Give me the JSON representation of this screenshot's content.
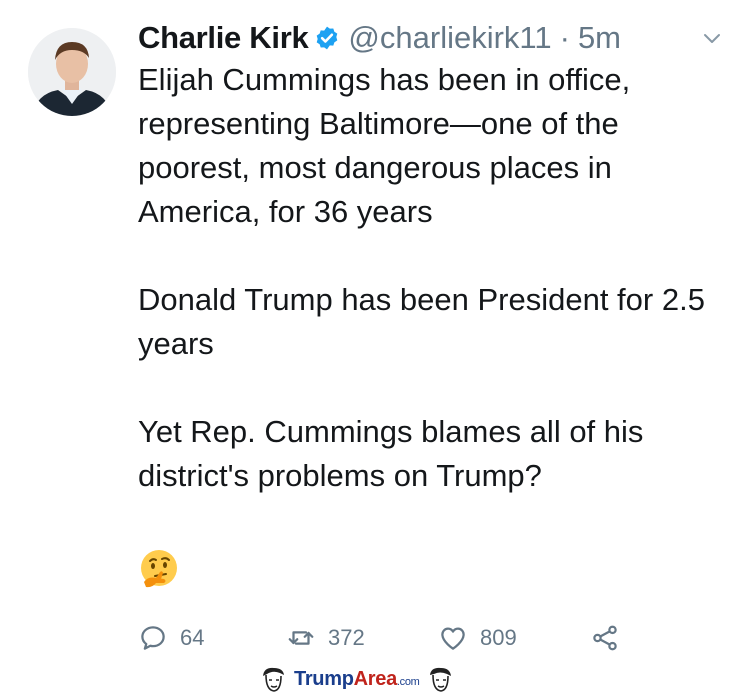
{
  "tweet": {
    "author_name": "Charlie Kirk",
    "handle": "@charliekirk11",
    "separator": "·",
    "time": "5m",
    "paragraphs": [
      "Elijah Cummings has been in office, representing Baltimore—one of the poorest, most dangerous places in America, for 36 years",
      "Donald Trump has been President for 2.5 years",
      "Yet Rep. Cummings blames all of his district's problems on Trump?"
    ],
    "emoji": "thinking-face-icon"
  },
  "actions": {
    "replies": "64",
    "retweets": "372",
    "likes": "809"
  },
  "watermark": {
    "part1": "Trump",
    "part2": "Area",
    "part3": ".com"
  },
  "colors": {
    "text": "#14171a",
    "secondary": "#657786",
    "verified": "#1da1f2"
  }
}
